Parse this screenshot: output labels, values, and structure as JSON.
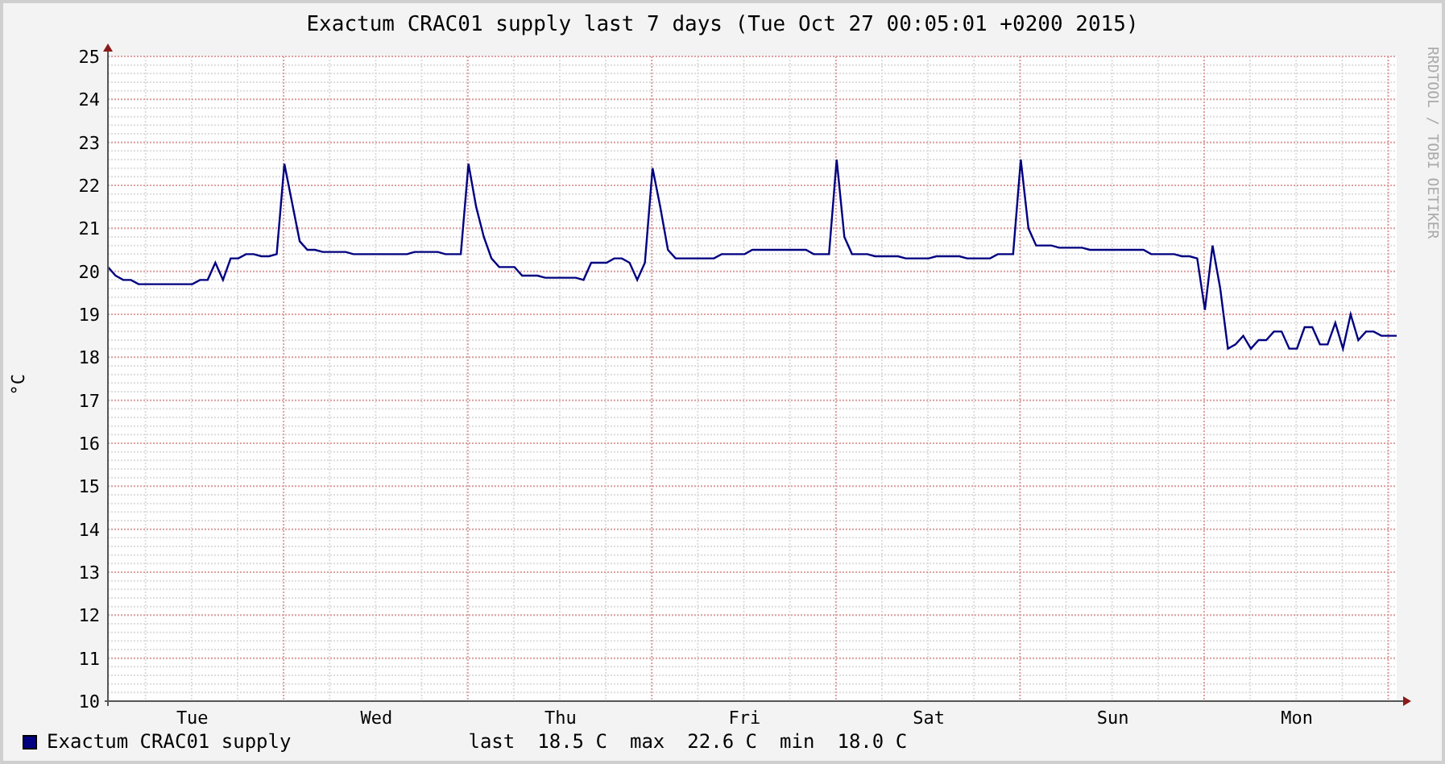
{
  "title": "Exactum CRAC01 supply last 7 days (Tue Oct 27 00:05:01 +0200 2015)",
  "credit": "RRDTOOL / TOBI OETIKER",
  "chart_data": {
    "type": "line",
    "ylabel": "°C",
    "categories": [
      null,
      null,
      null,
      null,
      null,
      null,
      null,
      null,
      null,
      null,
      null,
      "Tue",
      null,
      null,
      null,
      null,
      null,
      null,
      null,
      null,
      null,
      null,
      null,
      null,
      null,
      null,
      null,
      null,
      null,
      null,
      null,
      null,
      null,
      null,
      null,
      "Wed",
      null,
      null,
      null,
      null,
      null,
      null,
      null,
      null,
      null,
      null,
      null,
      null,
      null,
      null,
      null,
      null,
      null,
      null,
      null,
      null,
      null,
      null,
      null,
      "Thu",
      null,
      null,
      null,
      null,
      null,
      null,
      null,
      null,
      null,
      null,
      null,
      null,
      null,
      null,
      null,
      null,
      null,
      null,
      null,
      null,
      null,
      null,
      null,
      "Fri",
      null,
      null,
      null,
      null,
      null,
      null,
      null,
      null,
      null,
      null,
      null,
      null,
      null,
      null,
      null,
      null,
      null,
      null,
      null,
      null,
      null,
      null,
      null,
      "Sat",
      null,
      null,
      null,
      null,
      null,
      null,
      null,
      null,
      null,
      null,
      null,
      null,
      null,
      null,
      null,
      null,
      null,
      null,
      null,
      null,
      null,
      null,
      null,
      "Sun",
      null,
      null,
      null,
      null,
      null,
      null,
      null,
      null,
      null,
      null,
      null,
      null,
      null,
      null,
      null,
      null,
      null,
      null,
      null,
      null,
      null,
      null,
      null,
      "Mon",
      null,
      null,
      null,
      null,
      null,
      null,
      null,
      null,
      null,
      null,
      null,
      null,
      null
    ],
    "series": [
      {
        "name": "Exactum CRAC01 supply",
        "color": "#000080",
        "values": [
          20.1,
          19.9,
          19.8,
          19.8,
          19.7,
          19.7,
          19.7,
          19.7,
          19.7,
          19.7,
          19.7,
          19.7,
          19.8,
          19.8,
          20.2,
          19.8,
          20.3,
          20.3,
          20.4,
          20.4,
          20.35,
          20.35,
          20.4,
          22.5,
          21.6,
          20.7,
          20.5,
          20.5,
          20.45,
          20.45,
          20.45,
          20.45,
          20.4,
          20.4,
          20.4,
          20.4,
          20.4,
          20.4,
          20.4,
          20.4,
          20.45,
          20.45,
          20.45,
          20.45,
          20.4,
          20.4,
          20.4,
          22.5,
          21.5,
          20.8,
          20.3,
          20.1,
          20.1,
          20.1,
          19.9,
          19.9,
          19.9,
          19.85,
          19.85,
          19.85,
          19.85,
          19.85,
          19.8,
          20.2,
          20.2,
          20.2,
          20.3,
          20.3,
          20.2,
          19.8,
          20.2,
          22.4,
          21.5,
          20.5,
          20.3,
          20.3,
          20.3,
          20.3,
          20.3,
          20.3,
          20.4,
          20.4,
          20.4,
          20.4,
          20.5,
          20.5,
          20.5,
          20.5,
          20.5,
          20.5,
          20.5,
          20.5,
          20.4,
          20.4,
          20.4,
          22.6,
          20.8,
          20.4,
          20.4,
          20.4,
          20.35,
          20.35,
          20.35,
          20.35,
          20.3,
          20.3,
          20.3,
          20.3,
          20.35,
          20.35,
          20.35,
          20.35,
          20.3,
          20.3,
          20.3,
          20.3,
          20.4,
          20.4,
          20.4,
          22.6,
          21.0,
          20.6,
          20.6,
          20.6,
          20.55,
          20.55,
          20.55,
          20.55,
          20.5,
          20.5,
          20.5,
          20.5,
          20.5,
          20.5,
          20.5,
          20.5,
          20.4,
          20.4,
          20.4,
          20.4,
          20.35,
          20.35,
          20.3,
          19.1,
          20.6,
          19.6,
          18.2,
          18.3,
          18.5,
          18.2,
          18.4,
          18.4,
          18.6,
          18.6,
          18.2,
          18.2,
          18.7,
          18.7,
          18.3,
          18.3,
          18.8,
          18.2,
          19.0,
          18.4,
          18.6,
          18.6,
          18.5,
          18.5,
          18.5
        ]
      }
    ],
    "ylim": [
      10,
      25
    ],
    "grid": true,
    "yticks": [
      10,
      11,
      12,
      13,
      14,
      15,
      16,
      17,
      18,
      19,
      20,
      21,
      22,
      23,
      24,
      25
    ]
  },
  "legend": {
    "stats": [
      {
        "label": "last",
        "value": "18.5 C"
      },
      {
        "label": "max",
        "value": "22.6 C"
      },
      {
        "label": "min",
        "value": "18.0 C"
      }
    ]
  }
}
